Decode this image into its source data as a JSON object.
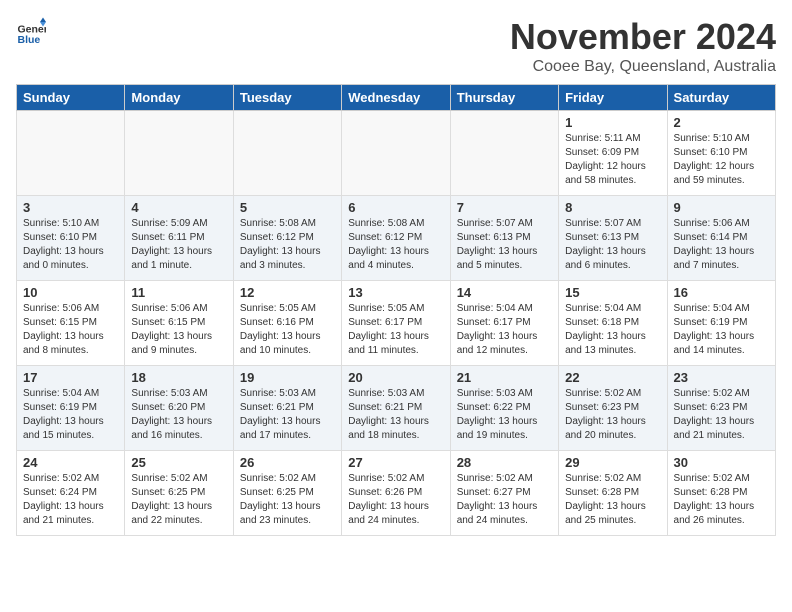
{
  "header": {
    "logo_general": "General",
    "logo_blue": "Blue",
    "month": "November 2024",
    "location": "Cooee Bay, Queensland, Australia"
  },
  "days_of_week": [
    "Sunday",
    "Monday",
    "Tuesday",
    "Wednesday",
    "Thursday",
    "Friday",
    "Saturday"
  ],
  "weeks": [
    [
      {
        "day": "",
        "info": "",
        "empty": true
      },
      {
        "day": "",
        "info": "",
        "empty": true
      },
      {
        "day": "",
        "info": "",
        "empty": true
      },
      {
        "day": "",
        "info": "",
        "empty": true
      },
      {
        "day": "",
        "info": "",
        "empty": true
      },
      {
        "day": "1",
        "info": "Sunrise: 5:11 AM\nSunset: 6:09 PM\nDaylight: 12 hours\nand 58 minutes."
      },
      {
        "day": "2",
        "info": "Sunrise: 5:10 AM\nSunset: 6:10 PM\nDaylight: 12 hours\nand 59 minutes."
      }
    ],
    [
      {
        "day": "3",
        "info": "Sunrise: 5:10 AM\nSunset: 6:10 PM\nDaylight: 13 hours\nand 0 minutes."
      },
      {
        "day": "4",
        "info": "Sunrise: 5:09 AM\nSunset: 6:11 PM\nDaylight: 13 hours\nand 1 minute."
      },
      {
        "day": "5",
        "info": "Sunrise: 5:08 AM\nSunset: 6:12 PM\nDaylight: 13 hours\nand 3 minutes."
      },
      {
        "day": "6",
        "info": "Sunrise: 5:08 AM\nSunset: 6:12 PM\nDaylight: 13 hours\nand 4 minutes."
      },
      {
        "day": "7",
        "info": "Sunrise: 5:07 AM\nSunset: 6:13 PM\nDaylight: 13 hours\nand 5 minutes."
      },
      {
        "day": "8",
        "info": "Sunrise: 5:07 AM\nSunset: 6:13 PM\nDaylight: 13 hours\nand 6 minutes."
      },
      {
        "day": "9",
        "info": "Sunrise: 5:06 AM\nSunset: 6:14 PM\nDaylight: 13 hours\nand 7 minutes."
      }
    ],
    [
      {
        "day": "10",
        "info": "Sunrise: 5:06 AM\nSunset: 6:15 PM\nDaylight: 13 hours\nand 8 minutes."
      },
      {
        "day": "11",
        "info": "Sunrise: 5:06 AM\nSunset: 6:15 PM\nDaylight: 13 hours\nand 9 minutes."
      },
      {
        "day": "12",
        "info": "Sunrise: 5:05 AM\nSunset: 6:16 PM\nDaylight: 13 hours\nand 10 minutes."
      },
      {
        "day": "13",
        "info": "Sunrise: 5:05 AM\nSunset: 6:17 PM\nDaylight: 13 hours\nand 11 minutes."
      },
      {
        "day": "14",
        "info": "Sunrise: 5:04 AM\nSunset: 6:17 PM\nDaylight: 13 hours\nand 12 minutes."
      },
      {
        "day": "15",
        "info": "Sunrise: 5:04 AM\nSunset: 6:18 PM\nDaylight: 13 hours\nand 13 minutes."
      },
      {
        "day": "16",
        "info": "Sunrise: 5:04 AM\nSunset: 6:19 PM\nDaylight: 13 hours\nand 14 minutes."
      }
    ],
    [
      {
        "day": "17",
        "info": "Sunrise: 5:04 AM\nSunset: 6:19 PM\nDaylight: 13 hours\nand 15 minutes."
      },
      {
        "day": "18",
        "info": "Sunrise: 5:03 AM\nSunset: 6:20 PM\nDaylight: 13 hours\nand 16 minutes."
      },
      {
        "day": "19",
        "info": "Sunrise: 5:03 AM\nSunset: 6:21 PM\nDaylight: 13 hours\nand 17 minutes."
      },
      {
        "day": "20",
        "info": "Sunrise: 5:03 AM\nSunset: 6:21 PM\nDaylight: 13 hours\nand 18 minutes."
      },
      {
        "day": "21",
        "info": "Sunrise: 5:03 AM\nSunset: 6:22 PM\nDaylight: 13 hours\nand 19 minutes."
      },
      {
        "day": "22",
        "info": "Sunrise: 5:02 AM\nSunset: 6:23 PM\nDaylight: 13 hours\nand 20 minutes."
      },
      {
        "day": "23",
        "info": "Sunrise: 5:02 AM\nSunset: 6:23 PM\nDaylight: 13 hours\nand 21 minutes."
      }
    ],
    [
      {
        "day": "24",
        "info": "Sunrise: 5:02 AM\nSunset: 6:24 PM\nDaylight: 13 hours\nand 21 minutes."
      },
      {
        "day": "25",
        "info": "Sunrise: 5:02 AM\nSunset: 6:25 PM\nDaylight: 13 hours\nand 22 minutes."
      },
      {
        "day": "26",
        "info": "Sunrise: 5:02 AM\nSunset: 6:25 PM\nDaylight: 13 hours\nand 23 minutes."
      },
      {
        "day": "27",
        "info": "Sunrise: 5:02 AM\nSunset: 6:26 PM\nDaylight: 13 hours\nand 24 minutes."
      },
      {
        "day": "28",
        "info": "Sunrise: 5:02 AM\nSunset: 6:27 PM\nDaylight: 13 hours\nand 24 minutes."
      },
      {
        "day": "29",
        "info": "Sunrise: 5:02 AM\nSunset: 6:28 PM\nDaylight: 13 hours\nand 25 minutes."
      },
      {
        "day": "30",
        "info": "Sunrise: 5:02 AM\nSunset: 6:28 PM\nDaylight: 13 hours\nand 26 minutes."
      }
    ]
  ]
}
